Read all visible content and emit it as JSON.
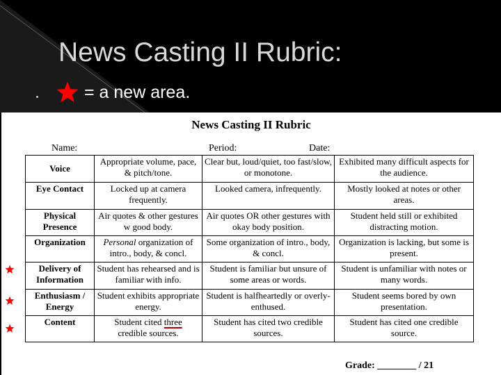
{
  "slide": {
    "title": "News Casting II Rubric:",
    "legend_text": "= a new area.",
    "legend_icon": "star-icon",
    "colors": {
      "background": "#000000",
      "title": "#d9d9d9",
      "star": "#ff0000",
      "underline": "#c00000"
    }
  },
  "document": {
    "title": "News Casting II Rubric",
    "fields": {
      "name": "Name:",
      "period": "Period:",
      "date": "Date:"
    },
    "rows": [
      {
        "criterion": "Voice",
        "levels": [
          "Appropriate volume, pace, & pitch/tone.",
          "Clear but, loud/quiet, too fast/slow, or monotone.",
          "Exhibited many difficult aspects for the audience."
        ],
        "new_area": false
      },
      {
        "criterion": "Eye Contact",
        "levels": [
          "Locked up at camera frequently.",
          "Looked camera, infrequently.",
          "Mostly looked at notes or other areas."
        ],
        "new_area": false
      },
      {
        "criterion": "Physical Presence",
        "levels": [
          "Air quotes & other gestures w good body.",
          "Air quotes OR other gestures with okay body position.",
          "Student held still or exhibited distracting motion."
        ],
        "new_area": false
      },
      {
        "criterion": "Organization",
        "levels": [
          "organization of intro., body, & concl.",
          "Some organization of intro., body, & concl.",
          "Organization is lacking, but some is present."
        ],
        "level1_italic_prefix": "Personal",
        "new_area": false
      },
      {
        "criterion": "Delivery of Information",
        "levels": [
          "Student has rehearsed and is familiar with info.",
          "Student is familiar but unsure of some areas or words.",
          "Student is unfamiliar with notes or many words."
        ],
        "new_area": true
      },
      {
        "criterion": "Enthusiasm / Energy",
        "levels": [
          "Student exhibits appropriate energy.",
          "Student is halfheartedly or overly-enthused.",
          "Student seems bored by own presentation."
        ],
        "new_area": true
      },
      {
        "criterion": "Content",
        "levels": [
          "credible sources.",
          "Student has cited two credible sources.",
          "Student has cited one credible source."
        ],
        "level1_prefix": "Student cited",
        "level1_underlined": "three",
        "new_area": true
      }
    ],
    "grade_label": "Grade: ________ / 21"
  }
}
